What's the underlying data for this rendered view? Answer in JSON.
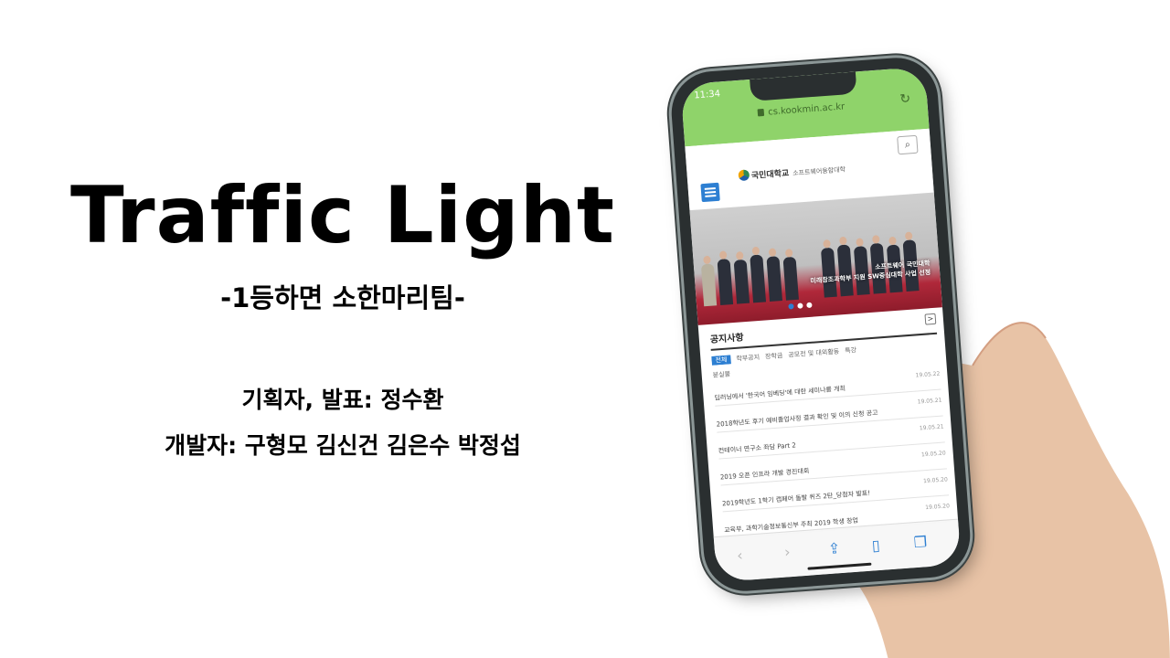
{
  "slide": {
    "title": "Traffic Light",
    "subtitle": "-1등하면 소한마리팀-",
    "credits": {
      "planner": "기획자, 발표: 정수환",
      "developers": "개발자: 구형모 김신건 김은수 박정섭"
    }
  },
  "phone": {
    "status_time": "11:34",
    "url": "cs.kookmin.ac.kr",
    "site": {
      "logo_text": "국민대학교",
      "logo_sub": "소프트웨어융합대학",
      "hero_caption_line1": "소프트웨어 국민대학",
      "hero_caption_line2": "미래창조과학부 지원 SW중심대학 사업 선정",
      "notice": {
        "title": "공지사항",
        "more": ">",
        "tabs": [
          "전체",
          "학부공지",
          "장학금",
          "공모전 및 대외활동",
          "특강"
        ],
        "extra_tab": "분실물",
        "rows": [
          {
            "title": "딥러닝에서 '한국어 임베딩'에 대한 세미나를 개최",
            "date": "19.05.22"
          },
          {
            "title": "2018학년도 후기 예비졸업사정 결과 확인 및 이의 신청 공고",
            "date": "19.05.21"
          },
          {
            "title": "컨테이너 연구소 좌담 Part 2",
            "date": "19.05.21"
          },
          {
            "title": "2019 오픈 인프라 개발 경진대회",
            "date": "19.05.20"
          },
          {
            "title": "2019학년도 1학기 캡페어 돌발 퀴즈 2탄_당첨자 발표!",
            "date": "19.05.20"
          },
          {
            "title": "교육부, 과학기술정보통신부 주최 2019 학생 창업",
            "date": "19.05.20"
          }
        ]
      }
    }
  },
  "colors": {
    "safari_bar": "#8fd36a",
    "accent_blue": "#2d7fd2"
  }
}
